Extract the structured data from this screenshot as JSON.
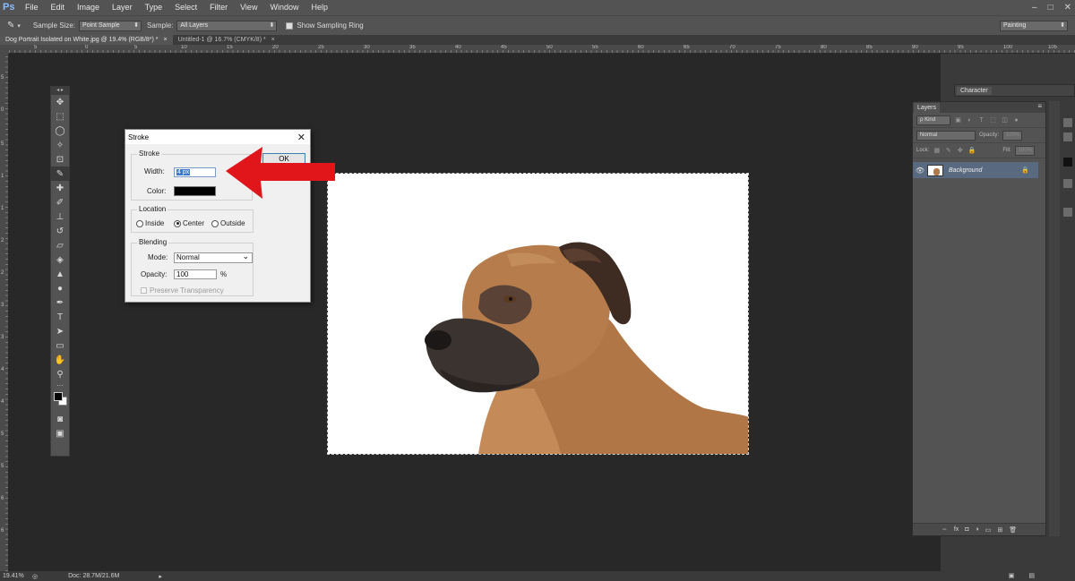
{
  "menubar": {
    "logo": "Ps",
    "items": [
      "File",
      "Edit",
      "Image",
      "Layer",
      "Type",
      "Select",
      "Filter",
      "View",
      "Window",
      "Help"
    ],
    "window_controls": [
      "–",
      "□",
      "✕"
    ]
  },
  "options": {
    "sample_size_label": "Sample Size:",
    "sample_size_value": "Point Sample",
    "sample_label": "Sample:",
    "sample_value": "All Layers",
    "show_ring_label": "Show Sampling Ring",
    "workspace": "Painting"
  },
  "tabs": [
    {
      "label": "Dog Portrait Isolated on White.jpg @ 19.4% (RGB/8*) *",
      "close": "×"
    },
    {
      "label": "Untitled-1 @ 16.7% (CMYK/8) *",
      "close": "×"
    }
  ],
  "ruler": {
    "h_ticks": [
      "5",
      "0",
      "5",
      "10",
      "15",
      "20",
      "25",
      "30",
      "35",
      "40",
      "45",
      "50",
      "55",
      "60",
      "65",
      "70",
      "75",
      "80",
      "85",
      "90",
      "95",
      "100",
      "105"
    ],
    "v_ticks": [
      "5",
      "0",
      "5",
      "1",
      "1",
      "2",
      "2",
      "3",
      "3",
      "4",
      "4",
      "5",
      "5",
      "6",
      "6",
      "7",
      "7",
      "8",
      "8",
      "9"
    ]
  },
  "tools_panel": {
    "header": "◂ ▸"
  },
  "stroke_dialog": {
    "title": "Stroke",
    "close": "✕",
    "ok": "OK",
    "stroke_group": {
      "legend": "Stroke",
      "width_label": "Width:",
      "width_value": "4 px",
      "color_label": "Color:"
    },
    "location_group": {
      "legend": "Location",
      "inside": "Inside",
      "center": "Center",
      "outside": "Outside",
      "selected": "Center"
    },
    "blending_group": {
      "legend": "Blending",
      "mode_label": "Mode:",
      "mode_value": "Normal",
      "opacity_label": "Opacity:",
      "opacity_value": "100",
      "percent": "%",
      "preserve_label": "Preserve Transparency"
    }
  },
  "panels": {
    "character_tab": "Character",
    "layers_tab": "Layers",
    "kind_label": "ρ Kind",
    "blend_mode": "Normal",
    "opacity_label": "Opacity:",
    "opacity_value": "100%",
    "lock_label": "Lock:",
    "fill_label": "Fill:",
    "fill_value": "100%",
    "layer_name": "Background",
    "footer_icons": [
      "⇔",
      "fx",
      "◘",
      "◑",
      "▭",
      "⊞",
      "🗑"
    ]
  },
  "status": {
    "zoom": "19.41%",
    "doc_info": "Doc: 28.7M/21.6M",
    "arrow": "▸"
  },
  "colors": {
    "accent_red": "#e0161b",
    "layer_selected": "#59697f",
    "dog_fur": "#b3794b"
  }
}
